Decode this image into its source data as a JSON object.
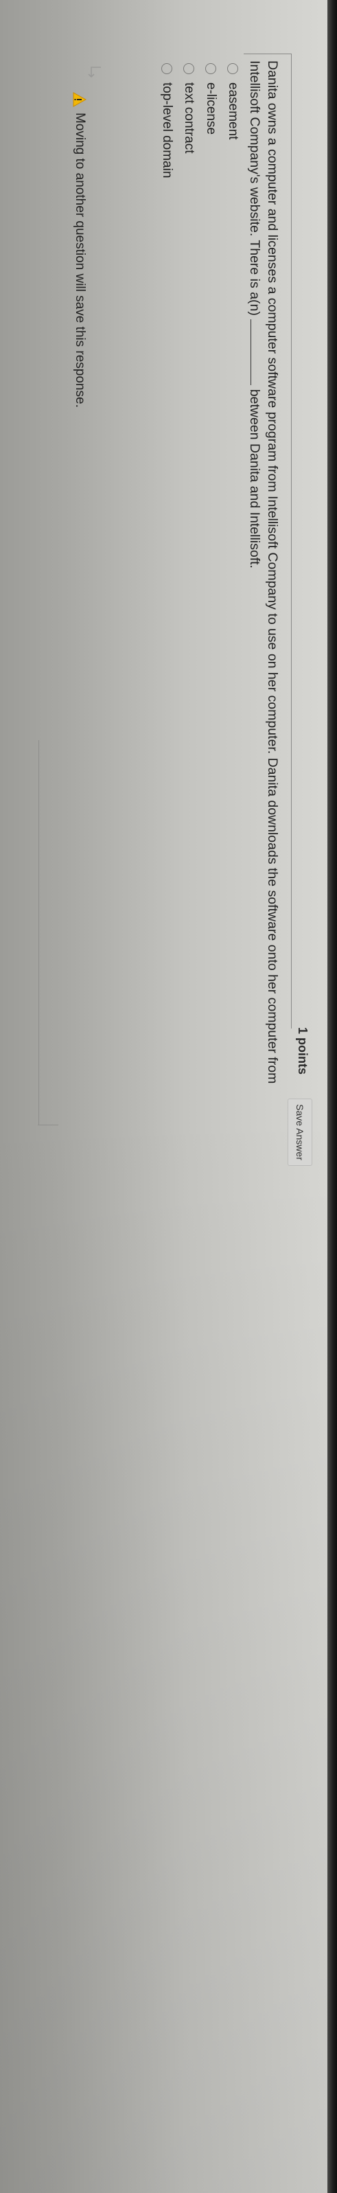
{
  "header": {
    "points": "1 points",
    "save_label": "Save Answer"
  },
  "question": {
    "text_before": "Danita owns a computer and licenses a computer software program from Intellisoft Company to use on her computer. Danita downloads the software onto her computer from Intellisoft Company's website. There is a(n)",
    "text_after": "between Danita and Intellisoft."
  },
  "options": [
    {
      "label": "easement",
      "selected": false
    },
    {
      "label": "e-license",
      "selected": false
    },
    {
      "label": "text contract",
      "selected": false
    },
    {
      "label": "top-level domain",
      "selected": false
    }
  ],
  "footer": {
    "warning": "Moving to another question will save this response."
  },
  "colors": {
    "warning_icon": "#f2b705",
    "text": "#222222",
    "save_button_bg": "#d6d6d4"
  },
  "icons": {
    "arrow": "arrow-return-icon",
    "warning": "warning-icon"
  }
}
